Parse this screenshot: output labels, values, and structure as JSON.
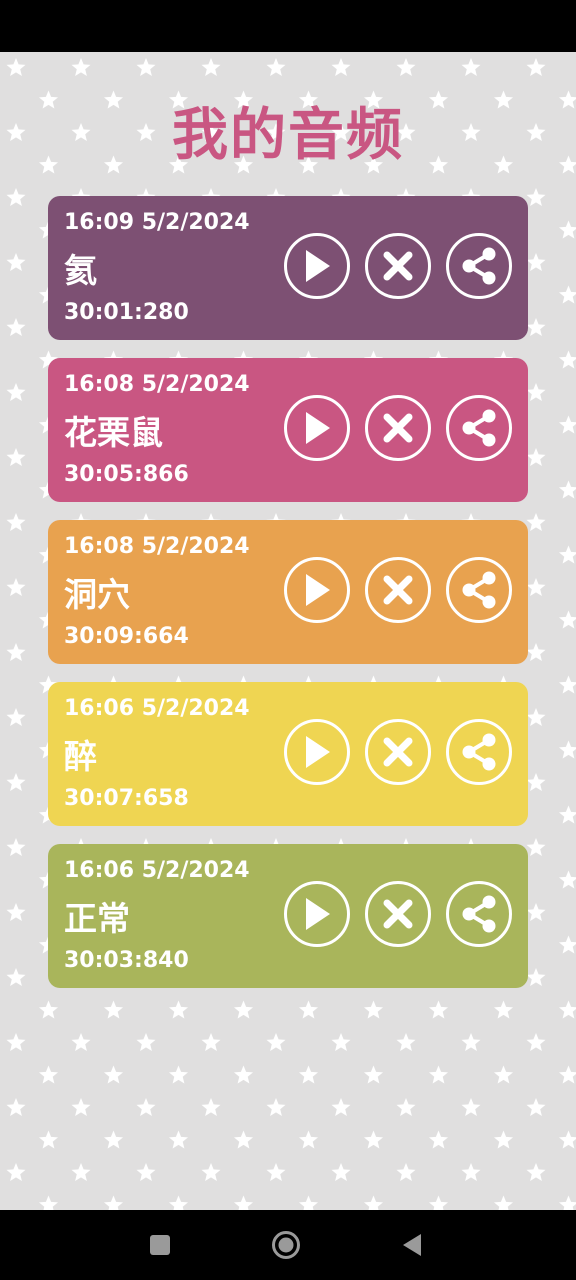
{
  "title": "我的音频",
  "colors": {
    "title": "#c95682",
    "cards": [
      "#7d5073",
      "#c95682",
      "#e8a24f",
      "#efd552",
      "#a9b55b"
    ]
  },
  "recordings": [
    {
      "timestamp": "16:09 5/2/2024",
      "name": "氦",
      "duration": "30:01:280"
    },
    {
      "timestamp": "16:08 5/2/2024",
      "name": "花栗鼠",
      "duration": "30:05:866"
    },
    {
      "timestamp": "16:08 5/2/2024",
      "name": "洞穴",
      "duration": "30:09:664"
    },
    {
      "timestamp": "16:06 5/2/2024",
      "name": "醉",
      "duration": "30:07:658"
    },
    {
      "timestamp": "16:06 5/2/2024",
      "name": "正常",
      "duration": "30:03:840"
    }
  ],
  "icons": {
    "play": "play-icon",
    "delete": "close-icon",
    "share": "share-icon",
    "nav_recents": "square-icon",
    "nav_home": "circle-icon",
    "nav_back": "triangle-back-icon"
  }
}
